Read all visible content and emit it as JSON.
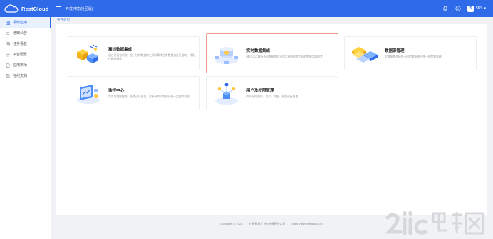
{
  "app": {
    "logo_text": "RestCloud",
    "env_title": "开发环境(社区版)"
  },
  "header": {
    "user_initial": "S",
    "user_name": "SBS"
  },
  "sidebar": {
    "items": [
      {
        "label": "系统应用",
        "icon": "app-grid-icon",
        "active": true
      },
      {
        "label": "通知公告",
        "icon": "megaphone-icon"
      },
      {
        "label": "任务看板",
        "icon": "clipboard-icon"
      },
      {
        "label": "平台配置",
        "icon": "settings-icon",
        "has_caret": true
      },
      {
        "label": "应用市场",
        "icon": "store-icon"
      },
      {
        "label": "在线文档",
        "icon": "document-icon"
      }
    ]
  },
  "breadcrumb": "平台首页",
  "cards": [
    {
      "title": "离线数据集成",
      "desc": "通过可视化的拖、拉、拽的数据库之间的离线任务数据流进行抽取、转换、传输等操作"
    },
    {
      "title": "实时数据集成",
      "desc": "通过CDC解析不同数据库的日志实现数据库之间的数据实时同步"
    },
    {
      "title": "数据源管理",
      "desc": "对数据库连接等不同的数据进行统一配置和管理"
    },
    {
      "title": "监控中心",
      "desc": "实时监控数据流、任务运行情况，对所有的异常进行统一监控和告警"
    },
    {
      "title": "用户及权限管理",
      "desc": "对平台的租户、用户、角色、权限进行管理"
    }
  ],
  "footer": {
    "copyright": "Copyright © 2023",
    "company": "谷云科技(广州)有限责任公司",
    "url": "https://www.restcloud.cn"
  },
  "colors": {
    "primary": "#2f6be8",
    "highlight_border": "#f19b8e"
  }
}
